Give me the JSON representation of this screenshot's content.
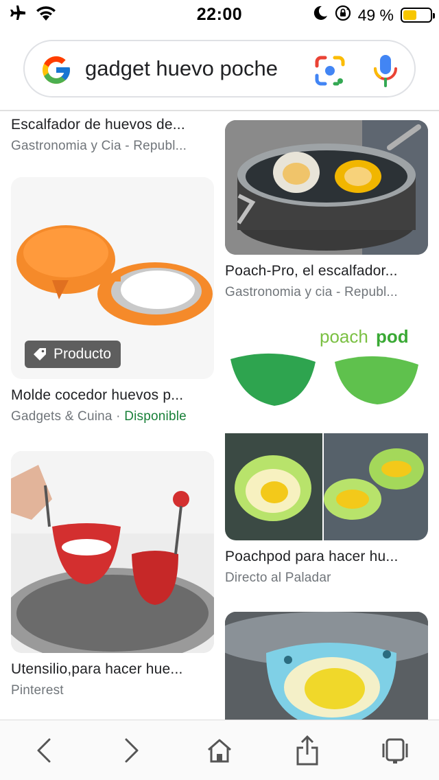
{
  "status_bar": {
    "time": "22:00",
    "battery_text": "49 %",
    "battery_level": 0.49,
    "icons": [
      "airplane-icon",
      "wifi-icon",
      "moon-icon",
      "rotation-lock-icon",
      "battery-icon"
    ]
  },
  "search": {
    "query": "gadget huevo poche",
    "icons": [
      "google-logo-icon",
      "google-lens-icon",
      "microphone-icon"
    ]
  },
  "results": [
    {
      "title": "Escalfador de huevos de...",
      "source": "Gastronomia y Cia - Republ..."
    },
    {
      "title": "Poach-Pro, el escalfador...",
      "source": "Gastronomia y cia - Republ..."
    },
    {
      "title": "Molde cocedor huevos p...",
      "source": "Gadgets & Cuina",
      "separator": " · ",
      "availability": "Disponible",
      "badge": "Producto"
    },
    {
      "title": "Poachpod para hacer hu...",
      "source": "Directo al Paladar",
      "image_text_a": "poach",
      "image_text_b": "pod"
    },
    {
      "title": "Utensilio,para hacer hue...",
      "source": "Pinterest"
    },
    {
      "title": "",
      "source": ""
    }
  ],
  "bottom_bar": {
    "icons": [
      "back-icon",
      "forward-icon",
      "home-icon",
      "share-icon",
      "tabs-icon"
    ]
  },
  "colors": {
    "availability_green": "#188038",
    "secondary_text": "#70757a",
    "battery_fill": "#f7c600"
  }
}
